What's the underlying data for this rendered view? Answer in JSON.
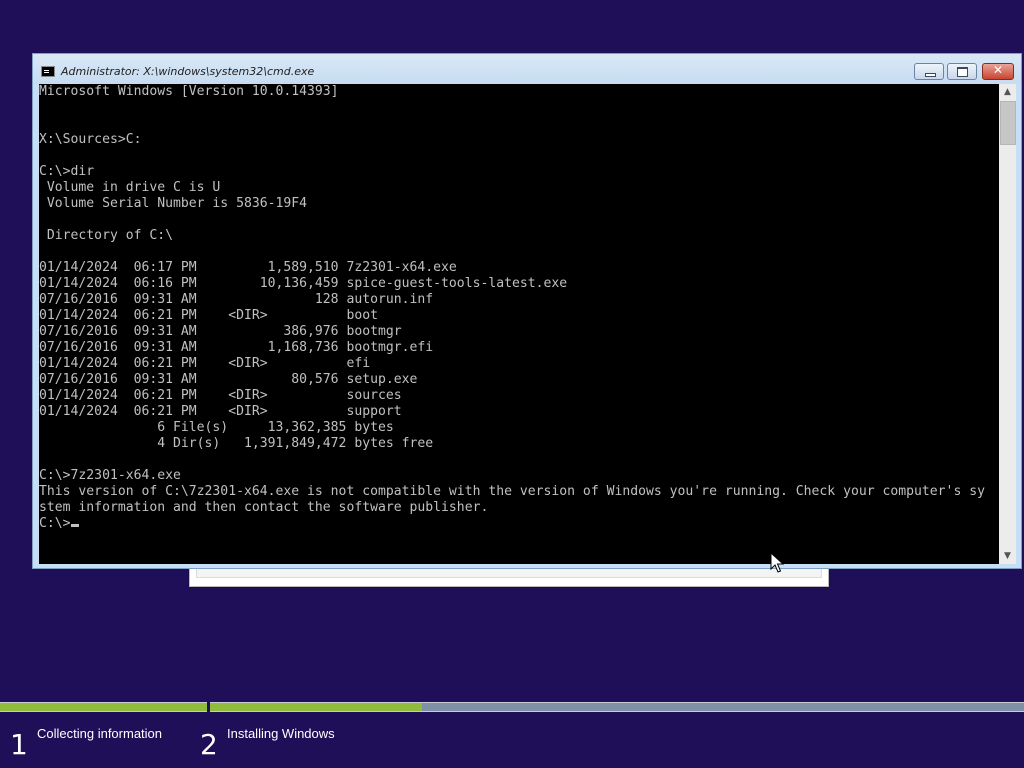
{
  "window": {
    "title": "Administrator: X:\\windows\\system32\\cmd.exe",
    "minimize_label": "",
    "maximize_label": "",
    "close_label": "✕"
  },
  "console": {
    "text": "Microsoft Windows [Version 10.0.14393]\n\n\nX:\\Sources>C:\n\nC:\\>dir\n Volume in drive C is U\n Volume Serial Number is 5836-19F4\n\n Directory of C:\\\n\n01/14/2024  06:17 PM         1,589,510 7z2301-x64.exe\n01/14/2024  06:16 PM        10,136,459 spice-guest-tools-latest.exe\n07/16/2016  09:31 AM               128 autorun.inf\n01/14/2024  06:21 PM    <DIR>          boot\n07/16/2016  09:31 AM           386,976 bootmgr\n07/16/2016  09:31 AM         1,168,736 bootmgr.efi\n01/14/2024  06:21 PM    <DIR>          efi\n07/16/2016  09:31 AM            80,576 setup.exe\n01/14/2024  06:21 PM    <DIR>          sources\n01/14/2024  06:21 PM    <DIR>          support\n               6 File(s)     13,362,385 bytes\n               4 Dir(s)   1,391,849,472 bytes free\n\nC:\\>7z2301-x64.exe\nThis version of C:\\7z2301-x64.exe is not compatible with the version of Windows you're running. Check your computer's sy\nstem information and then contact the software publisher.\n",
    "prompt": "C:\\>"
  },
  "scrollbar": {
    "up_icon": "chevron-up-icon",
    "down_icon": "chevron-down-icon",
    "up_glyph": "▲",
    "down_glyph": "▼"
  },
  "setup_progress": {
    "steps": [
      {
        "number": "1",
        "label": "Collecting information",
        "progress": 1.0
      },
      {
        "number": "2",
        "label": "Installing Windows",
        "progress": 0.26
      }
    ]
  },
  "colors": {
    "desktop_background": "#1f0f58",
    "console_background": "#000000",
    "console_text": "#c0c0c0",
    "progress_fill": "#8fbc3a",
    "progress_track": "#7f8fa6"
  }
}
